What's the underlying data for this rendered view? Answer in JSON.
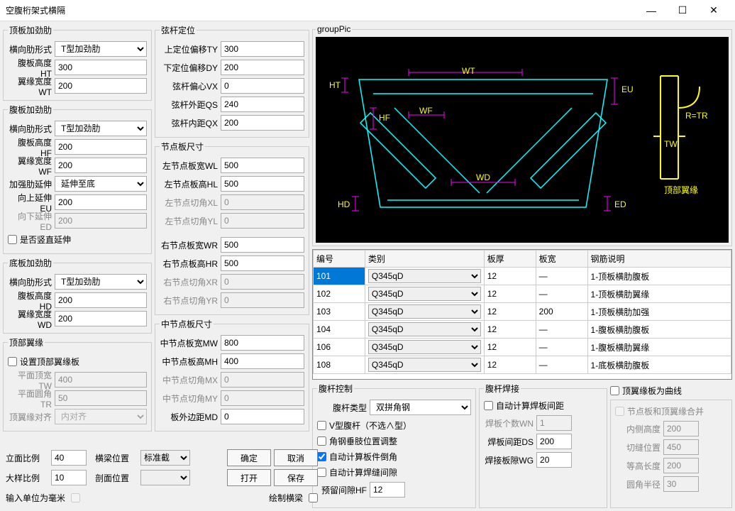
{
  "window": {
    "title": "空腹桁架式横隔"
  },
  "top_stiff": {
    "legend": "顶板加劲肋",
    "shape_label": "横向肋形式",
    "shape_value": "T型加劲肋",
    "ht_label": "腹板高度HT",
    "ht_value": "300",
    "wt_label": "翼缘宽度WT",
    "wt_value": "200"
  },
  "web_stiff": {
    "legend": "腹板加劲肋",
    "shape_label": "横向肋形式",
    "shape_value": "T型加劲肋",
    "hf_label": "腹板高度HF",
    "hf_value": "200",
    "wf_label": "翼缘宽度WF",
    "wf_value": "200",
    "ext_label": "加强肋延伸",
    "ext_value": "延伸至底",
    "eu_label": "向上延伸EU",
    "eu_value": "200",
    "ed_label": "向下延伸ED",
    "ed_value": "200",
    "vertical_ext_label": "是否竖直延伸"
  },
  "bottom_stiff": {
    "legend": "底板加劲肋",
    "shape_label": "横向肋形式",
    "shape_value": "T型加劲肋",
    "hd_label": "腹板高度HD",
    "hd_value": "200",
    "wd_label": "翼缘宽度WD",
    "wd_value": "200"
  },
  "top_flange": {
    "legend": "顶部翼缘",
    "set_top_flange_label": "设置顶部翼缘板",
    "tw_label": "平面顶宽TW",
    "tw_value": "400",
    "tr_label": "平面圆角TR",
    "tr_value": "50",
    "align_label": "顶翼缘对齐",
    "align_value": "内对齐"
  },
  "chord_pos": {
    "legend": "弦杆定位",
    "ty_label": "上定位偏移TY",
    "ty_value": "300",
    "dy_label": "下定位偏移DY",
    "dy_value": "200",
    "vx_label": "弦杆偏心VX",
    "vx_value": "0",
    "qs_label": "弦杆外距QS",
    "qs_value": "240",
    "qx_label": "弦杆内距QX",
    "qx_value": "200"
  },
  "node_plate": {
    "legend": "节点板尺寸",
    "wl_label": "左节点板宽WL",
    "wl_value": "500",
    "hl_label": "左节点板高HL",
    "hl_value": "500",
    "xl_label": "左节点切角XL",
    "xl_value": "0",
    "yl_label": "左节点切角YL",
    "yl_value": "0",
    "wr_label": "右节点板宽WR",
    "wr_value": "500",
    "hr_label": "右节点板高HR",
    "hr_value": "500",
    "xr_label": "右节点切角XR",
    "xr_value": "0",
    "yr_label": "右节点切角YR",
    "yr_value": "0"
  },
  "mid_node": {
    "legend": "中节点板尺寸",
    "mw_label": "中节点板宽MW",
    "mw_value": "800",
    "mh_label": "中节点板高MH",
    "mh_value": "400",
    "mx_label": "中节点切角MX",
    "mx_value": "0",
    "my_label": "中节点切角MY",
    "my_value": "0",
    "md_label": "板外边距MD",
    "md_value": "0"
  },
  "diagram_legend": "groupPic",
  "diagram_labels": {
    "HT": "HT",
    "WT": "WT",
    "EU": "EU",
    "HF": "HF",
    "WF": "WF",
    "WD": "WD",
    "HD": "HD",
    "ED": "ED",
    "RTR": "R=TR",
    "TW": "TW",
    "top_flange": "顶部翼缘"
  },
  "table": {
    "headers": [
      "编号",
      "类别",
      "板厚",
      "板宽",
      "钢筋说明"
    ],
    "rows": [
      {
        "id": "101",
        "cat": "Q345qD",
        "thk": "12",
        "width": "—",
        "desc": "1-顶板横肋腹板",
        "sel": true
      },
      {
        "id": "102",
        "cat": "Q345qD",
        "thk": "12",
        "width": "—",
        "desc": "1-顶板横肋翼缘"
      },
      {
        "id": "103",
        "cat": "Q345qD",
        "thk": "12",
        "width": "200",
        "desc": "1-顶板横肋加强"
      },
      {
        "id": "104",
        "cat": "Q345qD",
        "thk": "12",
        "width": "—",
        "desc": "1-腹板横肋腹板"
      },
      {
        "id": "106",
        "cat": "Q345qD",
        "thk": "12",
        "width": "—",
        "desc": "1-腹板横肋翼缘"
      },
      {
        "id": "108",
        "cat": "Q345qD",
        "thk": "12",
        "width": "—",
        "desc": "1-底板横肋腹板"
      }
    ]
  },
  "web_ctrl": {
    "legend": "腹杆控制",
    "type_label": "腹杆类型",
    "type_value": "双拼角钢",
    "v_label": "V型腹杆（不选∧型）",
    "angle_adj_label": "角钢垂肢位置调整",
    "auto_chamfer_label": "自动计算板件倒角",
    "auto_chamfer_checked": true,
    "auto_weld_gap_label": "自动计算焊缝间隙",
    "hf_label": "预留间隙HF",
    "hf_value": "12"
  },
  "web_weld": {
    "legend": "腹杆焊接",
    "auto_calc_label": "自动计算焊板间距",
    "wn_label": "焊板个数WN",
    "wn_value": "1",
    "ds_label": "焊板间距DS",
    "ds_value": "200",
    "wg_label": "焊接板隙WG",
    "wg_value": "20"
  },
  "curve_flange": {
    "chk_label": "顶翼缘板为曲线",
    "merge_label": "节点板和顶翼缘合并",
    "inner_h_label": "内侧高度",
    "inner_h_value": "200",
    "cut_pos_label": "切缝位置",
    "cut_pos_value": "450",
    "eq_len_label": "等高长度",
    "eq_len_value": "200",
    "fillet_label": "圆角半径",
    "fillet_value": "30"
  },
  "footer": {
    "elev_ratio_label": "立面比例",
    "elev_ratio_value": "40",
    "big_ratio_label": "大样比例",
    "big_ratio_value": "10",
    "unit_label": "输入单位为毫米",
    "beam_pos_label": "横梁位置",
    "beam_pos_value": "标准截",
    "section_pos_label": "剖面位置",
    "draw_beam_label": "绘制横梁",
    "ok": "确定",
    "cancel": "取消",
    "open": "打开",
    "save": "保存"
  }
}
